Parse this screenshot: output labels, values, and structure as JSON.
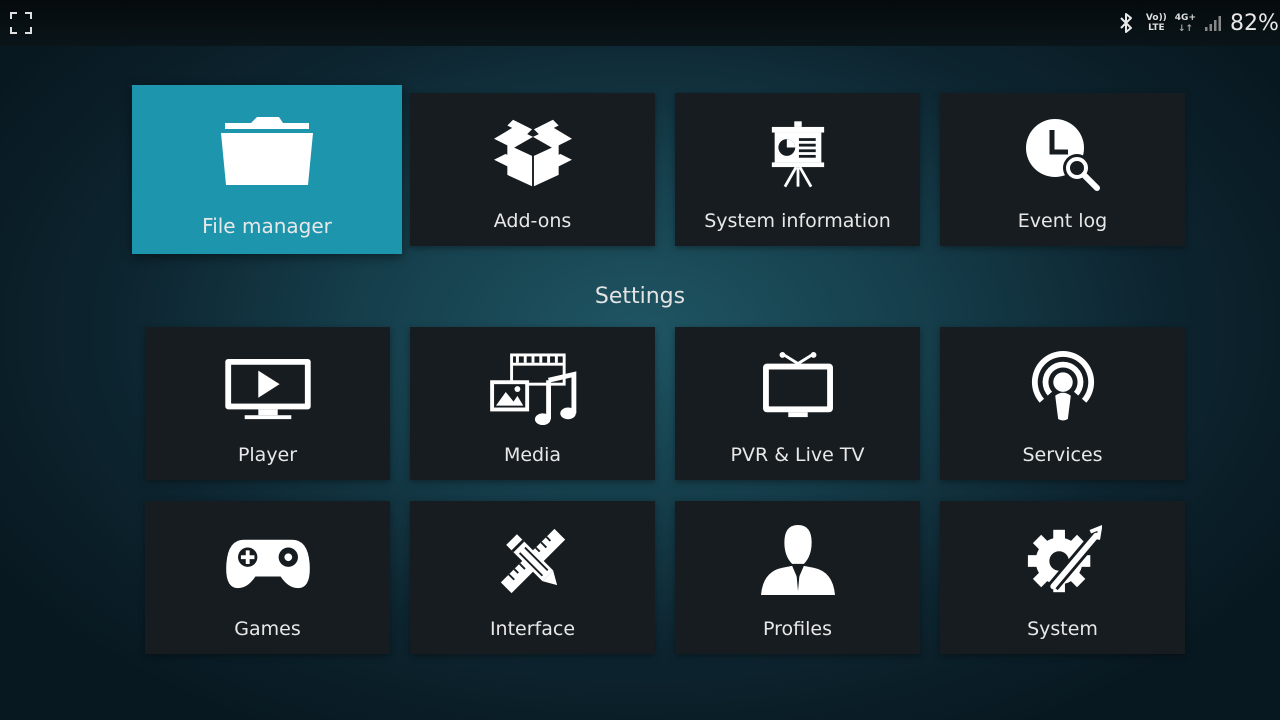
{
  "status_bar": {
    "icons": [
      "fullscreen-corner-icon",
      "bluetooth-icon",
      "signal-bars-icon"
    ],
    "volte_top": "Vo))",
    "volte_bottom": "LTE",
    "network_type": "4G+",
    "network_arrows": "↓↑",
    "battery": "82%"
  },
  "colors": {
    "focus_accent": "#1d95ad",
    "tile_background": "#161c20",
    "background_center": "#1f5563",
    "background_edge": "#081820"
  },
  "top_row": [
    {
      "label": "File manager",
      "icon": "folder-icon",
      "focused": true
    },
    {
      "label": "Add-ons",
      "icon": "open-box-icon",
      "focused": false
    },
    {
      "label": "System information",
      "icon": "presentation-board-icon",
      "focused": false
    },
    {
      "label": "Event log",
      "icon": "clock-magnifier-icon",
      "focused": false
    }
  ],
  "settings_title": "Settings",
  "settings": [
    {
      "label": "Player",
      "icon": "monitor-play-icon"
    },
    {
      "label": "Media",
      "icon": "media-film-photo-music-icon"
    },
    {
      "label": "PVR & Live TV",
      "icon": "tv-antenna-icon"
    },
    {
      "label": "Services",
      "icon": "broadcast-podcast-icon"
    },
    {
      "label": "Games",
      "icon": "gamepad-icon"
    },
    {
      "label": "Interface",
      "icon": "pencil-ruler-icon"
    },
    {
      "label": "Profiles",
      "icon": "user-profile-icon"
    },
    {
      "label": "System",
      "icon": "gear-wrench-icon"
    }
  ]
}
